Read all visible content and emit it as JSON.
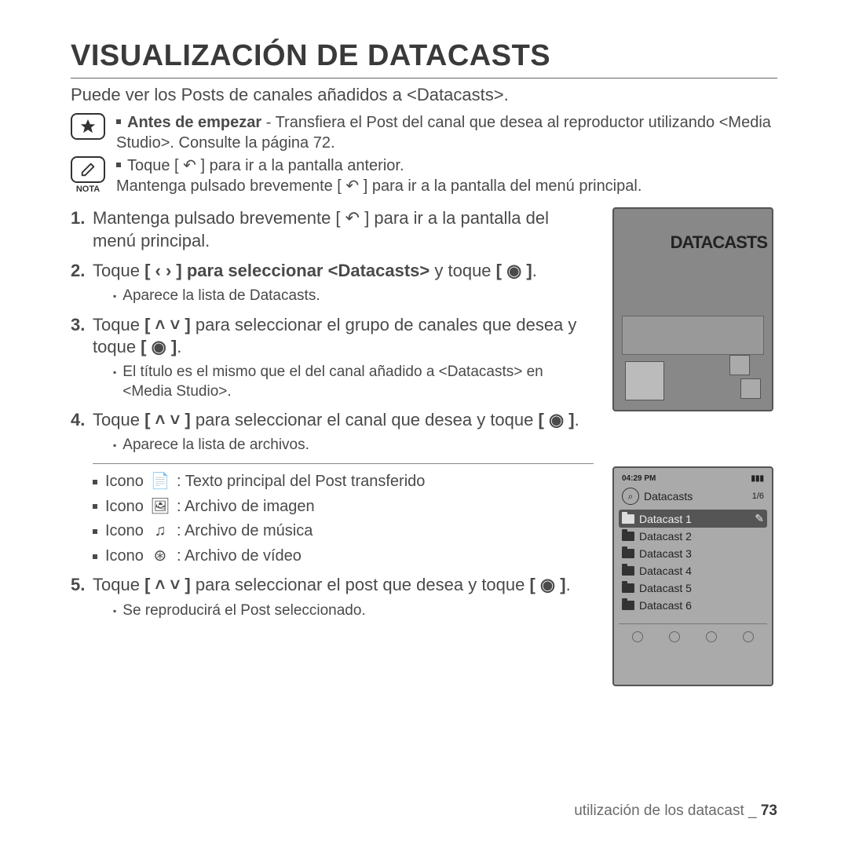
{
  "title": "VISUALIZACIÓN DE DATACASTS",
  "intro": "Puede ver los Posts de canales añadidos a <Datacasts>.",
  "note1_bold": "Antes de empezar",
  "note1_rest": " - Transfiera el Post del canal que desea al reproductor utilizando <Media Studio>. Consulte la página 72.",
  "note2a": "Toque [ ↶ ] para ir a la pantalla anterior.",
  "note2b": "Mantenga pulsado brevemente [ ↶ ] para ir a la pantalla del menú principal.",
  "nota_label": "NOTA",
  "steps": {
    "s1": "Mantenga pulsado brevemente [ ↶ ] para ir a la pantalla del menú principal.",
    "s2a": "Toque ",
    "s2b": " para seleccionar ",
    "s2c": "<Datacasts>",
    "s2d": " y toque ",
    "s2sub": "Aparece la lista de Datacasts.",
    "s3a": "Toque ",
    "s3b": " para seleccionar el grupo de canales que desea y toque ",
    "s3sub": "El título es el mismo que el del canal añadido a <Datacasts> en <Media Studio>.",
    "s4a": "Toque ",
    "s4b": " para seleccionar el canal que desea y toque ",
    "s4sub": "Aparece la lista de archivos.",
    "s5a": "Toque ",
    "s5b": " para seleccionar el post que desea y toque ",
    "s5sub": "Se reproducirá el Post seleccionado."
  },
  "icons": {
    "prefix": "Icono",
    "i1": ": Texto principal del Post transferido",
    "i2": ": Archivo de imagen",
    "i3": ": Archivo de música",
    "i4": ": Archivo de vídeo"
  },
  "device1_banner": "DATACASTS",
  "device2": {
    "time": "04:29 PM",
    "header": "Datacasts",
    "count": "1/6",
    "items": [
      "Datacast 1",
      "Datacast 2",
      "Datacast 3",
      "Datacast 4",
      "Datacast 5",
      "Datacast 6"
    ]
  },
  "footer_text": "utilización de los datacast _",
  "footer_page": "73",
  "glyph_lr": "[ ‹  › ]",
  "glyph_ud": "[ ˄ ˅ ]",
  "glyph_ok": "[ ◉ ]"
}
